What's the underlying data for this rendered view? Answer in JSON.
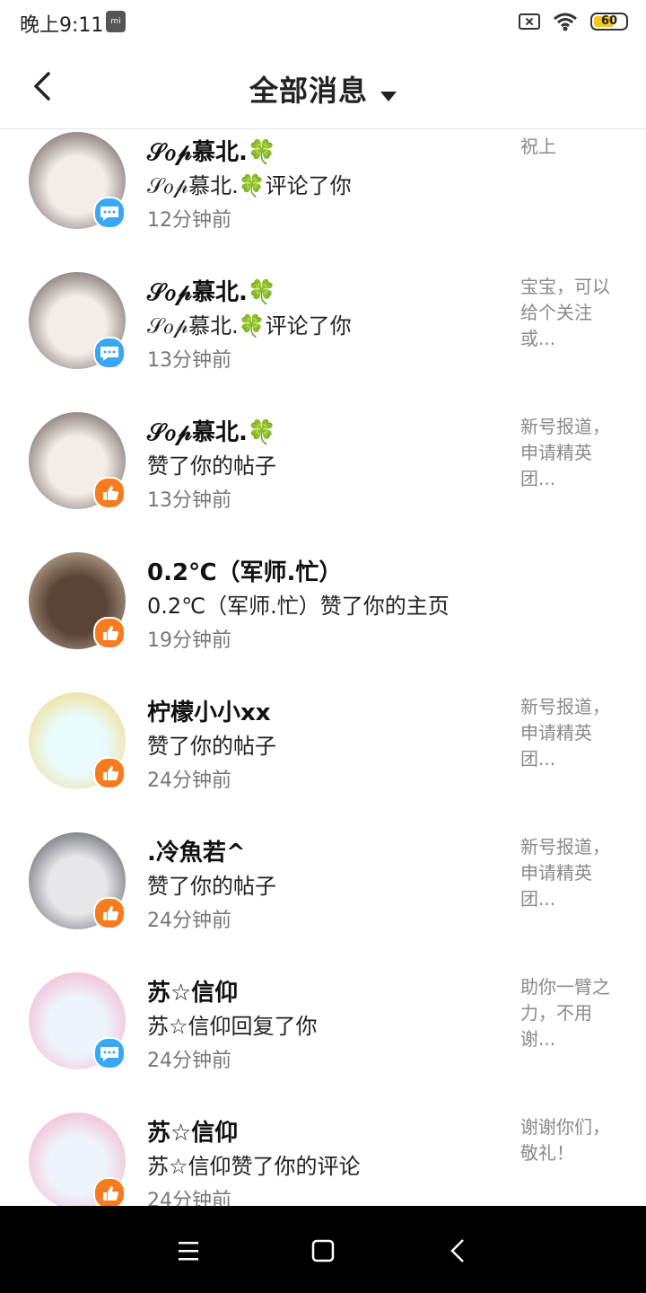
{
  "status_bar": {
    "time": "晚上9:11",
    "battery": "60"
  },
  "header": {
    "title": "全部消息"
  },
  "notifications": [
    {
      "name": "𝒮𝑜𝓅慕北.🍀",
      "action": "𝒮𝑜𝓅慕北.🍀评论了你",
      "time": "12分钟前",
      "preview": "祝上",
      "badge": "comment"
    },
    {
      "name": "𝒮𝑜𝓅慕北.🍀",
      "action": "𝒮𝑜𝓅慕北.🍀评论了你",
      "time": "13分钟前",
      "preview": "宝宝，可以给个关注或...",
      "badge": "comment"
    },
    {
      "name": "𝒮𝑜𝓅慕北.🍀",
      "action": "赞了你的帖子",
      "time": "13分钟前",
      "preview": "新号报道，申请精英团...",
      "badge": "like"
    },
    {
      "name": "0.2℃（军师.忙）",
      "action": "0.2℃（军师.忙）赞了你的主页",
      "time": "19分钟前",
      "preview": "",
      "badge": "like"
    },
    {
      "name": "柠檬小小xx",
      "action": "赞了你的帖子",
      "time": "24分钟前",
      "preview": "新号报道，申请精英团...",
      "badge": "like"
    },
    {
      "name": ".冷魚若^",
      "action": "赞了你的帖子",
      "time": "24分钟前",
      "preview": "新号报道，申请精英团...",
      "badge": "like"
    },
    {
      "name": "苏☆信仰",
      "action": "苏☆信仰回复了你",
      "time": "24分钟前",
      "preview": "助你一臂之力，不用谢...",
      "badge": "comment"
    },
    {
      "name": "苏☆信仰",
      "action": "苏☆信仰赞了你的评论",
      "time": "24分钟前",
      "preview": "谢谢你们，敬礼！",
      "badge": "like"
    }
  ]
}
